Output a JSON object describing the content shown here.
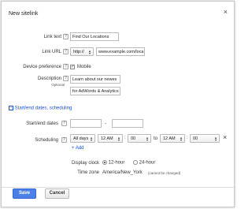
{
  "dialog": {
    "title": "New sitelink",
    "close_icon": "close-icon"
  },
  "form": {
    "link_text": {
      "label": "Link text",
      "value": "Find Our Locations"
    },
    "link_url": {
      "label": "Link URL",
      "protocol": "http://",
      "value": "www.example.com/loca"
    },
    "device_preference": {
      "label": "Device preference",
      "option": "Mobile",
      "checked": true
    },
    "description": {
      "label": "Description",
      "sublabel": "Optional",
      "line1": "Learn about our newes",
      "line2": "for AdWords & Analytics"
    }
  },
  "schedule": {
    "section_label": "Start/end dates, scheduling",
    "start_end_label": "Start/end dates",
    "date_separator": "-",
    "scheduling_label": "Scheduling",
    "days": "All days",
    "from_hour": "12 AM",
    "from_min": "00",
    "to_word": "to",
    "to_hour": "12 AM",
    "to_min": "00",
    "time_separator": ":",
    "add_link": "+ Add",
    "remove_icon": "×",
    "display_clock_label": "Display clock",
    "clock_12": "12-hour",
    "clock_24": "24-hour",
    "clock_selected": "12-hour",
    "time_zone_label": "Time zone",
    "time_zone_value": "America/New_York",
    "time_zone_note": "(cannot be changed)"
  },
  "footer": {
    "save_label": "Save",
    "cancel_label": "Cancel"
  },
  "colors": {
    "accent": "#1a4fc9",
    "save_button": "#4d7fe8"
  }
}
